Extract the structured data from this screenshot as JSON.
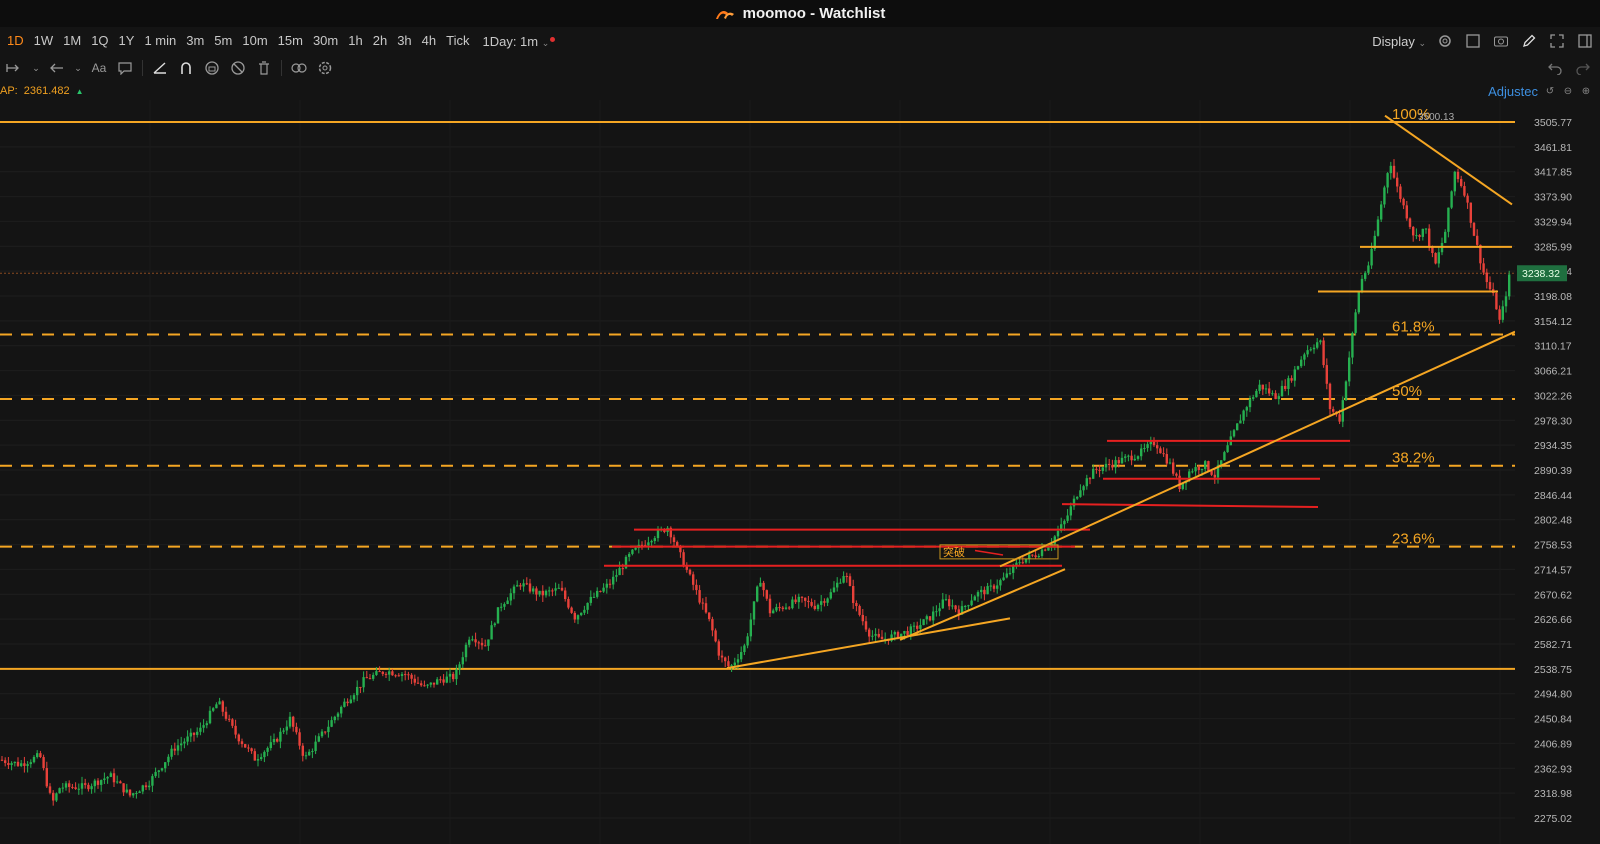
{
  "window": {
    "title": "moomoo - Watchlist"
  },
  "toolbar": {
    "timeframes": [
      "1D",
      "1W",
      "1M",
      "1Q",
      "1Y",
      "1 min",
      "3m",
      "5m",
      "10m",
      "15m",
      "30m",
      "1h",
      "2h",
      "3h",
      "4h",
      "Tick"
    ],
    "active_timeframe": "1D",
    "combined_label": "1Day: 1m",
    "display_label": "Display"
  },
  "drawing_tools": [
    "cursor-icon",
    "arrow-icon",
    "text-icon",
    "comment-icon",
    "line-icon",
    "magnet-icon",
    "lock-icon",
    "eye-icon",
    "trash-icon",
    "link-icon",
    "gear-icon"
  ],
  "indicator": {
    "label": "AP:",
    "value": "2361.482"
  },
  "adjusted_label": "Adjustec",
  "colors": {
    "accent": "#ff8a1a",
    "up": "#26b050",
    "down": "#e8413a",
    "fib": "#f5a623",
    "red_line": "#e62020",
    "bg": "#141414"
  },
  "chart_data": {
    "type": "candlestick",
    "y_ticks": [
      "3505.77",
      "3461.81",
      "3417.85",
      "3373.90",
      "3329.94",
      "3285.99",
      "3242.04",
      "3198.08",
      "3154.12",
      "3110.17",
      "3066.21",
      "3022.26",
      "2978.30",
      "2934.35",
      "2890.39",
      "2846.44",
      "2802.48",
      "2758.53",
      "2714.57",
      "2670.62",
      "2626.66",
      "2582.71",
      "2538.75",
      "2494.80",
      "2450.84",
      "2406.89",
      "2362.93",
      "2318.98",
      "2275.02"
    ],
    "current_price": "3238.32",
    "high_label": "3500.13",
    "fib_levels": [
      {
        "label": "100%",
        "price": 3505.77
      },
      {
        "label": "61.8%",
        "price": 3130.0
      },
      {
        "label": "50%",
        "price": 3016.0
      },
      {
        "label": "38.2%",
        "price": 2898.0
      },
      {
        "label": "23.6%",
        "price": 2755.0
      }
    ],
    "support_level": 2538.75,
    "annotation": "突破",
    "path": [
      [
        0,
        2378
      ],
      [
        20,
        2370
      ],
      [
        40,
        2385
      ],
      [
        52,
        2300
      ],
      [
        60,
        2330
      ],
      [
        85,
        2330
      ],
      [
        110,
        2350
      ],
      [
        130,
        2315
      ],
      [
        150,
        2340
      ],
      [
        175,
        2400
      ],
      [
        200,
        2430
      ],
      [
        218,
        2480
      ],
      [
        235,
        2425
      ],
      [
        255,
        2380
      ],
      [
        275,
        2410
      ],
      [
        290,
        2450
      ],
      [
        305,
        2380
      ],
      [
        325,
        2430
      ],
      [
        345,
        2480
      ],
      [
        365,
        2520
      ],
      [
        385,
        2535
      ],
      [
        405,
        2530
      ],
      [
        425,
        2505
      ],
      [
        440,
        2520
      ],
      [
        455,
        2525
      ],
      [
        470,
        2600
      ],
      [
        485,
        2580
      ],
      [
        500,
        2650
      ],
      [
        520,
        2690
      ],
      [
        540,
        2670
      ],
      [
        560,
        2680
      ],
      [
        575,
        2630
      ],
      [
        590,
        2660
      ],
      [
        610,
        2690
      ],
      [
        630,
        2740
      ],
      [
        650,
        2770
      ],
      [
        668,
        2790
      ],
      [
        680,
        2740
      ],
      [
        695,
        2680
      ],
      [
        710,
        2620
      ],
      [
        720,
        2560
      ],
      [
        730,
        2540
      ],
      [
        745,
        2580
      ],
      [
        760,
        2700
      ],
      [
        770,
        2640
      ],
      [
        785,
        2650
      ],
      [
        800,
        2660
      ],
      [
        815,
        2650
      ],
      [
        830,
        2670
      ],
      [
        845,
        2710
      ],
      [
        855,
        2650
      ],
      [
        870,
        2600
      ],
      [
        880,
        2590
      ],
      [
        900,
        2600
      ],
      [
        915,
        2610
      ],
      [
        930,
        2630
      ],
      [
        945,
        2660
      ],
      [
        960,
        2640
      ],
      [
        975,
        2670
      ],
      [
        990,
        2680
      ],
      [
        1005,
        2700
      ],
      [
        1020,
        2730
      ],
      [
        1035,
        2740
      ],
      [
        1050,
        2760
      ],
      [
        1065,
        2800
      ],
      [
        1080,
        2860
      ],
      [
        1095,
        2890
      ],
      [
        1110,
        2900
      ],
      [
        1125,
        2910
      ],
      [
        1140,
        2920
      ],
      [
        1155,
        2940
      ],
      [
        1170,
        2900
      ],
      [
        1180,
        2860
      ],
      [
        1190,
        2890
      ],
      [
        1205,
        2900
      ],
      [
        1215,
        2880
      ],
      [
        1230,
        2940
      ],
      [
        1245,
        3000
      ],
      [
        1260,
        3040
      ],
      [
        1275,
        3020
      ],
      [
        1290,
        3050
      ],
      [
        1305,
        3100
      ],
      [
        1320,
        3120
      ],
      [
        1330,
        3000
      ],
      [
        1340,
        2980
      ],
      [
        1350,
        3100
      ],
      [
        1360,
        3220
      ],
      [
        1370,
        3260
      ],
      [
        1380,
        3350
      ],
      [
        1390,
        3440
      ],
      [
        1395,
        3400
      ],
      [
        1405,
        3350
      ],
      [
        1415,
        3300
      ],
      [
        1425,
        3320
      ],
      [
        1435,
        3250
      ],
      [
        1445,
        3310
      ],
      [
        1455,
        3420
      ],
      [
        1465,
        3380
      ],
      [
        1475,
        3300
      ],
      [
        1485,
        3230
      ],
      [
        1495,
        3190
      ],
      [
        1500,
        3150
      ],
      [
        1510,
        3238
      ]
    ]
  }
}
